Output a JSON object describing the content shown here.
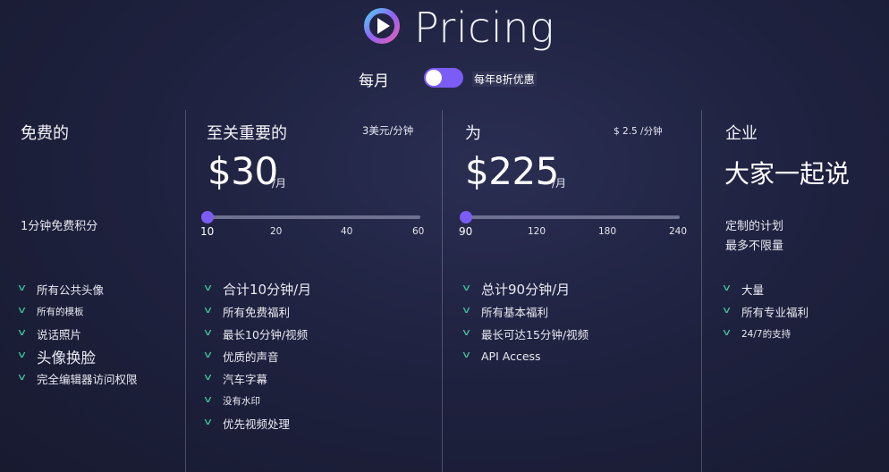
{
  "header": {
    "title": "Pricing"
  },
  "billing": {
    "monthly_label": "每月",
    "yearly_label": "每年8折优惠"
  },
  "plans": [
    {
      "name": "免费的",
      "subtitle": "1分钟免费积分",
      "features": [
        "所有公共头像",
        "所有的模板",
        "说话照片",
        "头像换脸",
        "完全编辑器访问权限"
      ]
    },
    {
      "name": "至关重要的",
      "rate": "3美元/分钟",
      "price": "$30",
      "per": "/月",
      "slider": {
        "ticks": [
          "10",
          "20",
          "40",
          "60"
        ],
        "value": "10"
      },
      "features": [
        "合计10分钟/月",
        "所有免费福利",
        "最长10分钟/视频",
        "优质的声音",
        "汽车字幕",
        "没有水印",
        "优先视频处理"
      ]
    },
    {
      "name": "为",
      "rate": "$ 2.5 /分钟",
      "price": "$225",
      "per": "/月",
      "slider": {
        "ticks": [
          "90",
          "120",
          "180",
          "240"
        ],
        "value": "90"
      },
      "features": [
        "总计90分钟/月",
        "所有基本福利",
        "最长可达15分钟/视频",
        "API Access"
      ]
    },
    {
      "name": "企业",
      "headline": "大家一起说",
      "subtitle_lines": [
        "定制的计划",
        "最多不限量"
      ],
      "features": [
        "大量",
        "所有专业福利",
        "24/7的支持"
      ]
    }
  ],
  "icons": {
    "logo": "play-logo-icon",
    "feature": "check-icon"
  },
  "colors": {
    "accent": "#7b5cf5",
    "check": "#3fd0a4",
    "background": "#1f2240"
  }
}
